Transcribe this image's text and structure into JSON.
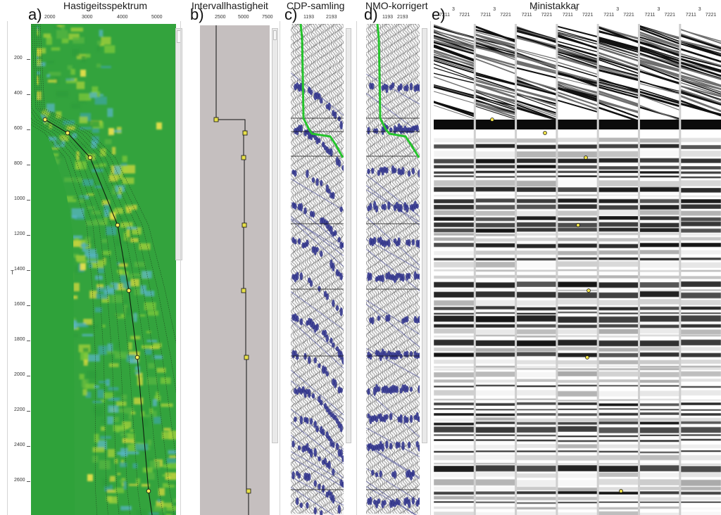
{
  "titles": {
    "a": "Hastigeitsspektrum",
    "b": "Intervallhastigheit",
    "c": "CDP-samling",
    "d": "NMO-korrigert",
    "e": "Ministakkar"
  },
  "labels": {
    "a": "a)",
    "b": "b)",
    "c": "c)",
    "d": "d)",
    "e": "e)"
  },
  "panel_a": {
    "x_ticks": [
      "2000",
      "3000",
      "4000",
      "5000"
    ],
    "y_ticks": [
      "200",
      "400",
      "600",
      "800",
      "1000",
      "1200",
      "1400",
      "1600",
      "1800",
      "2000",
      "2200",
      "2400",
      "2600"
    ],
    "y_axis_label": "T"
  },
  "panel_b": {
    "x_ticks": [
      "2500",
      "5000",
      "7500"
    ]
  },
  "panel_c": {
    "x_ticks": [
      "1193",
      "2193"
    ]
  },
  "panel_d": {
    "x_ticks": [
      "1193",
      "2193"
    ]
  },
  "panel_e": {
    "column_headers": [
      {
        "top": "3",
        "left": "7211",
        "right": "7221"
      },
      {
        "top": "3",
        "left": "7211",
        "right": "7221"
      },
      {
        "top": "3",
        "left": "7211",
        "right": "7221"
      },
      {
        "top": "3",
        "left": "7211",
        "right": "7221"
      },
      {
        "top": "3",
        "left": "7211",
        "right": "7221"
      },
      {
        "top": "3",
        "left": "7211",
        "right": "7221"
      },
      {
        "top": "3",
        "left": "7211",
        "right": "7221"
      }
    ]
  },
  "colors": {
    "spectrum_green": "#2fa23a",
    "pick_yellow": "#f2e84a",
    "nmo_curve_green": "#22c02a",
    "seismic_blue": "#2b2f8a",
    "interval_bg": "#c5bfbf"
  }
}
